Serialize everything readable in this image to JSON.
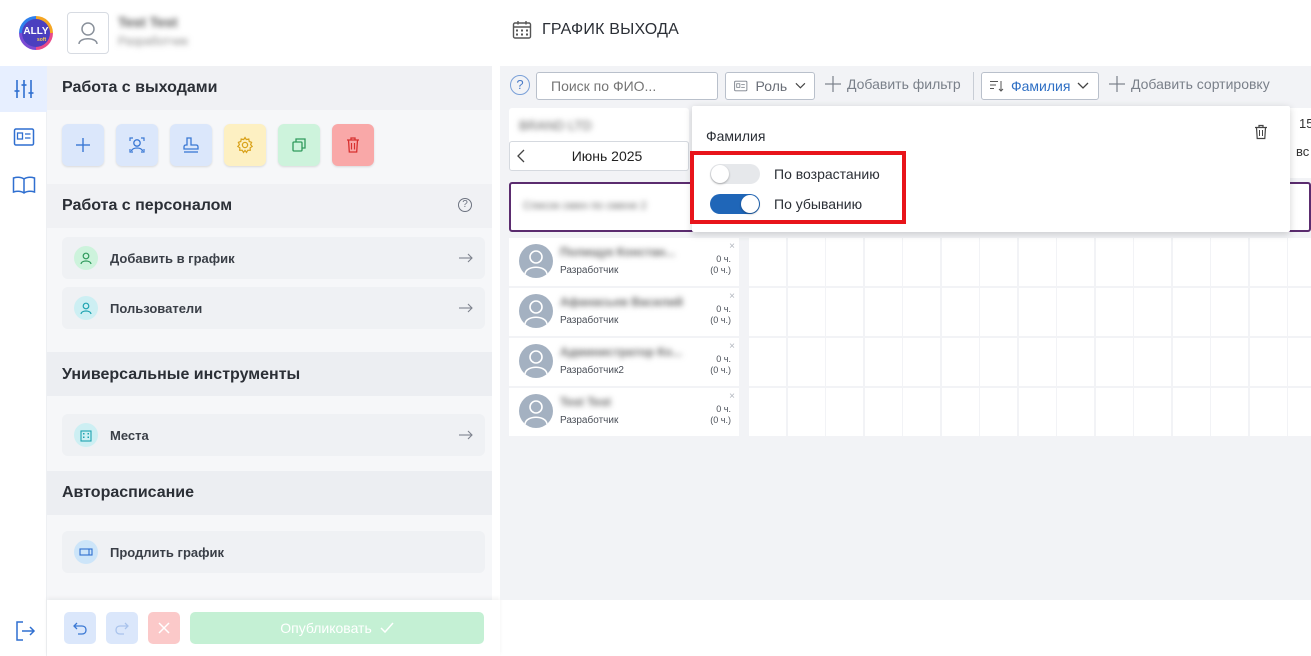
{
  "header": {
    "logo_text": "ALLY",
    "logo_sub": "soft",
    "user_name": "Test Test",
    "user_role": "Разработчик",
    "page_title": "ГРАФИК ВЫХОДА"
  },
  "sidebar": {
    "rail_items": [
      {
        "icon": "sliders-icon",
        "active": true
      },
      {
        "icon": "id-card-icon",
        "active": false
      },
      {
        "icon": "book-icon",
        "active": false
      }
    ],
    "logout_icon": "logout-icon"
  },
  "panel": {
    "section_exits": "Работа с выходами",
    "tools": [
      {
        "icon": "plus-icon",
        "color": "#dbe7fb"
      },
      {
        "icon": "user-search-icon",
        "color": "#dbe7fb"
      },
      {
        "icon": "stamp-icon",
        "color": "#dbe7fb"
      },
      {
        "icon": "gear-icon",
        "color": "#fdf0c2"
      },
      {
        "icon": "copy-icon",
        "color": "#cdf3dc"
      },
      {
        "icon": "trash-icon",
        "color": "#f9a8a8"
      }
    ],
    "section_staff": "Работа с персоналом",
    "add_to_schedule": "Добавить в график",
    "users": "Пользователи",
    "section_universal": "Универсальные инструменты",
    "places": "Места",
    "section_auto": "Авторасписание",
    "extend_schedule": "Продлить график"
  },
  "bottom": {
    "publish_label": "Опубликовать"
  },
  "toolbar": {
    "help": "?",
    "search_placeholder": "Поиск по ФИО...",
    "role_label": "Роль",
    "add_filter": "Добавить фильтр",
    "sort_label": "Фамилия",
    "add_sort": "Добавить сортировку"
  },
  "schedule": {
    "org_name": "BRAND LTD",
    "month_label": "Июнь 2025",
    "right_top": "15",
    "right_bottom": "вс",
    "group_label": "Список смен по смене 2",
    "employees": [
      {
        "name": "Полищук Констан...",
        "role": "Разработчик",
        "hours": "0 ч.",
        "hours_sub": "(0 ч.)"
      },
      {
        "name": "Афанасьев Василий",
        "role": "Разработчик",
        "hours": "0 ч.",
        "hours_sub": "(0 ч.)"
      },
      {
        "name": "Администратор Ко...",
        "role": "Разработчик2",
        "hours": "0 ч.",
        "hours_sub": "(0 ч.)"
      },
      {
        "name": "Test Test",
        "role": "Разработчик",
        "hours": "0 ч.",
        "hours_sub": "(0 ч.)"
      }
    ],
    "remove_glyph": "×"
  },
  "sort_popup": {
    "title": "Фамилия",
    "ascending_label": "По возрастанию",
    "ascending_on": false,
    "descending_label": "По убыванию",
    "descending_on": true,
    "highlight_color": "#e8141a"
  }
}
